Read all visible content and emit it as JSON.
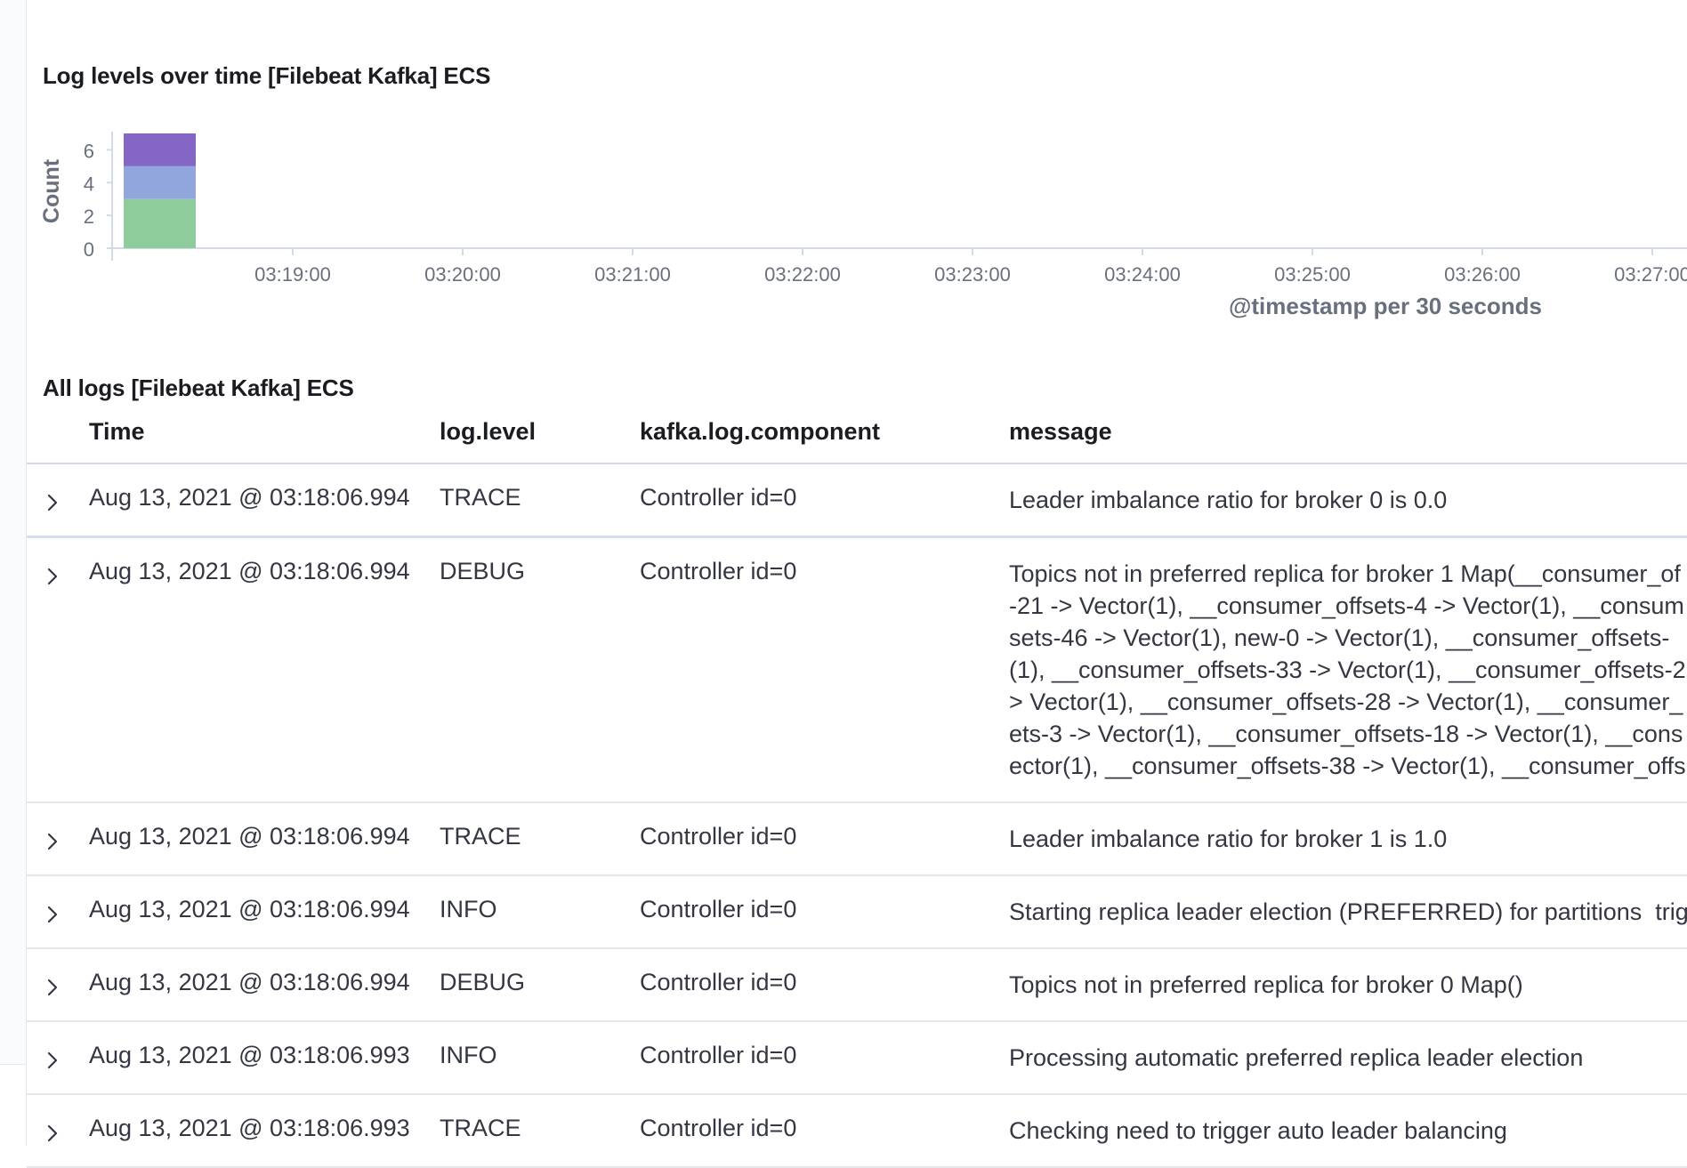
{
  "chart_panel": {
    "title": "Log levels over time [Filebeat Kafka] ECS"
  },
  "chart_data": {
    "type": "bar",
    "stacked": true,
    "title": "Log levels over time [Filebeat Kafka] ECS",
    "ylabel": "Count",
    "xlabel": "@timestamp per 30 seconds",
    "y_ticks": [
      "0",
      "2",
      "4",
      "6"
    ],
    "ylim": [
      0,
      7
    ],
    "x_tick_labels": [
      "03:19:00",
      "03:20:00",
      "03:21:00",
      "03:22:00",
      "03:23:00",
      "03:24:00",
      "03:25:00",
      "03:26:00",
      "03:27:00"
    ],
    "categories": [
      "03:18:00"
    ],
    "series": [
      {
        "color": "#8fcc9c",
        "values": [
          3
        ]
      },
      {
        "color": "#92a6de",
        "values": [
          2
        ]
      },
      {
        "color": "#8466c4",
        "values": [
          2
        ]
      }
    ],
    "grid": false
  },
  "logs_panel": {
    "title": "All logs [Filebeat Kafka] ECS",
    "columns": [
      "Time",
      "log.level",
      "kafka.log.component",
      "message"
    ],
    "rows": [
      {
        "time": "Aug 13, 2021 @ 03:18:06.994",
        "level": "TRACE",
        "component": "Controller id=0",
        "message": "Leader imbalance ratio for broker 0 is 0.0"
      },
      {
        "time": "Aug 13, 2021 @ 03:18:06.994",
        "level": "DEBUG",
        "component": "Controller id=0",
        "message": "Topics not in preferred replica for broker 1 Map(__consumer_of\n-21 -> Vector(1), __consumer_offsets-4 -> Vector(1), __consum\nsets-46 -> Vector(1), new-0 -> Vector(1), __consumer_offsets-\n(1), __consumer_offsets-33 -> Vector(1), __consumer_offsets-2\n> Vector(1), __consumer_offsets-28 -> Vector(1), __consumer_\nets-3 -> Vector(1), __consumer_offsets-18 -> Vector(1), __cons\nector(1), __consumer_offsets-38 -> Vector(1), __consumer_offs"
      },
      {
        "time": "Aug 13, 2021 @ 03:18:06.994",
        "level": "TRACE",
        "component": "Controller id=0",
        "message": "Leader imbalance ratio for broker 1 is 1.0"
      },
      {
        "time": "Aug 13, 2021 @ 03:18:06.994",
        "level": "INFO",
        "component": "Controller id=0",
        "message": "Starting replica leader election (PREFERRED) for partitions  trig"
      },
      {
        "time": "Aug 13, 2021 @ 03:18:06.994",
        "level": "DEBUG",
        "component": "Controller id=0",
        "message": "Topics not in preferred replica for broker 0 Map()"
      },
      {
        "time": "Aug 13, 2021 @ 03:18:06.993",
        "level": "INFO",
        "component": "Controller id=0",
        "message": "Processing automatic preferred replica leader election"
      },
      {
        "time": "Aug 13, 2021 @ 03:18:06.993",
        "level": "TRACE",
        "component": "Controller id=0",
        "message": "Checking need to trigger auto leader balancing"
      }
    ]
  }
}
